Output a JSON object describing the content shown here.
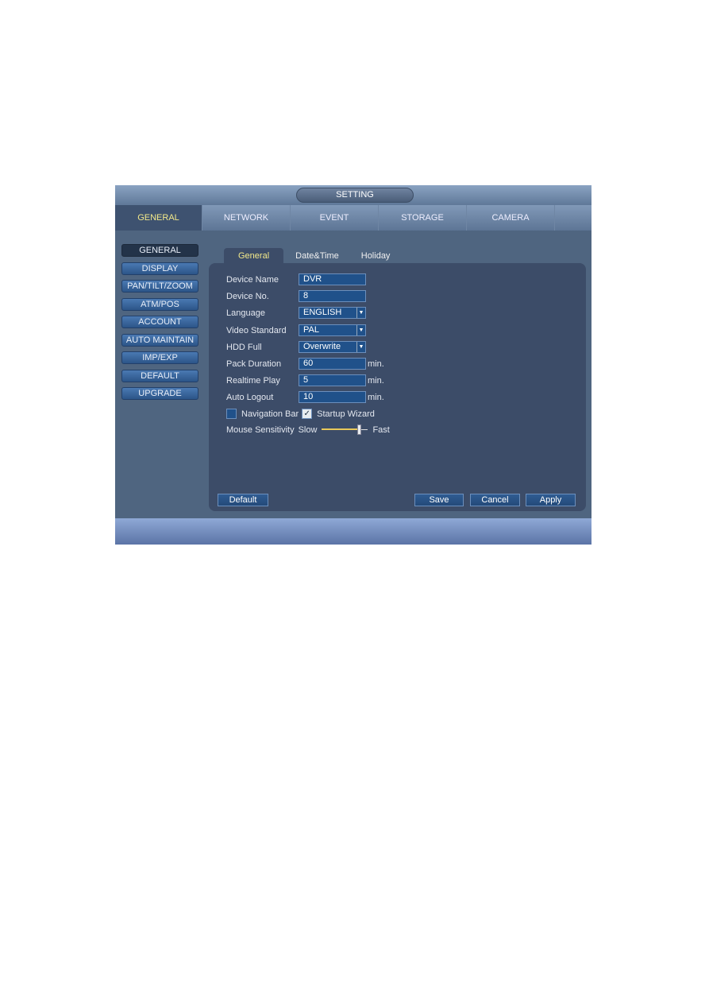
{
  "header": {
    "title": "SETTING"
  },
  "top_tabs": [
    {
      "label": "GENERAL",
      "active": true
    },
    {
      "label": "NETWORK"
    },
    {
      "label": "EVENT"
    },
    {
      "label": "STORAGE"
    },
    {
      "label": "CAMERA"
    }
  ],
  "sidebar": {
    "items": [
      {
        "label": "GENERAL",
        "active": true
      },
      {
        "label": "DISPLAY"
      },
      {
        "label": "PAN/TILT/ZOOM"
      },
      {
        "label": "ATM/POS"
      },
      {
        "label": "ACCOUNT"
      },
      {
        "label": "AUTO MAINTAIN"
      },
      {
        "label": "IMP/EXP"
      },
      {
        "label": "DEFAULT"
      },
      {
        "label": "UPGRADE"
      }
    ]
  },
  "sub_tabs": [
    {
      "label": "General",
      "active": true
    },
    {
      "label": "Date&Time"
    },
    {
      "label": "Holiday"
    }
  ],
  "form": {
    "device_name": {
      "label": "Device Name",
      "value": "DVR"
    },
    "device_no": {
      "label": "Device No.",
      "value": "8"
    },
    "language": {
      "label": "Language",
      "value": "ENGLISH"
    },
    "video_standard": {
      "label": "Video Standard",
      "value": "PAL"
    },
    "hdd_full": {
      "label": "HDD Full",
      "value": "Overwrite"
    },
    "pack_duration": {
      "label": "Pack Duration",
      "value": "60",
      "unit": "min."
    },
    "realtime_play": {
      "label": "Realtime Play",
      "value": "5",
      "unit": "min."
    },
    "auto_logout": {
      "label": "Auto Logout",
      "value": "10",
      "unit": "min."
    },
    "navigation_bar": {
      "label": "Navigation Bar",
      "checked": false
    },
    "startup_wizard": {
      "label": "Startup Wizard",
      "checked": true,
      "check_glyph": "✓"
    },
    "mouse_sensitivity": {
      "label": "Mouse Sensitivity",
      "min_label": "Slow",
      "max_label": "Fast",
      "level_percent": 80
    }
  },
  "buttons": {
    "default": "Default",
    "save": "Save",
    "cancel": "Cancel",
    "apply": "Apply"
  },
  "colors": {
    "active_tab_text": "#f3e98a",
    "input_bg": "#20518a",
    "panel_bg": "#3c4c68"
  }
}
